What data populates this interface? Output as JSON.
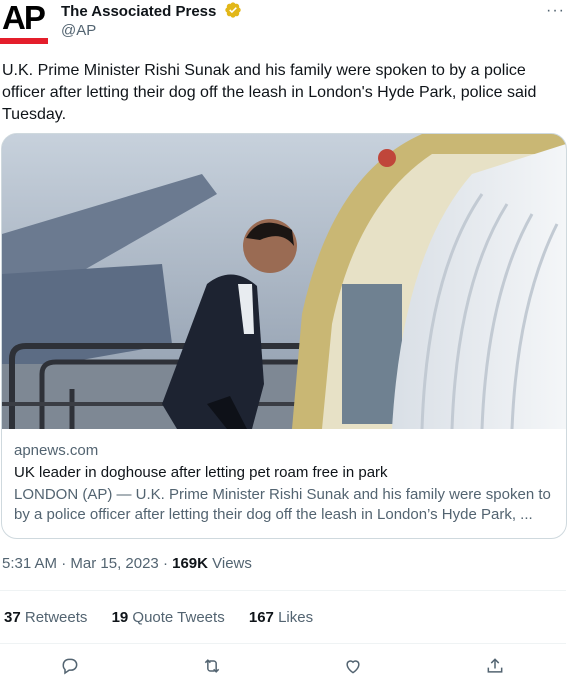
{
  "author": {
    "avatar_text": "AP",
    "display_name": "The Associated Press",
    "handle": "@AP",
    "verified_icon": "verified-badge-icon",
    "more_label": "···"
  },
  "tweet": {
    "text": "U.K. Prime Minister Rishi Sunak and his family were spoken to by a police officer after letting their dog off the leash in London's Hyde Park, police said Tuesday."
  },
  "card": {
    "image_alt": "Rishi Sunak boarding an aircraft",
    "domain": "apnews.com",
    "title": "UK leader in doghouse after letting pet roam free in park",
    "description": "LONDON (AP) — U.K. Prime Minister Rishi Sunak and his family were spoken to by a police officer after letting their dog off the leash in London’s Hyde Park, ..."
  },
  "meta": {
    "time": "5:31 AM",
    "separator": " · ",
    "date": "Mar 15, 2023",
    "views_count": "169K",
    "views_label": " Views"
  },
  "stats": {
    "retweets_count": "37",
    "retweets_label": " Retweets",
    "quotes_count": "19",
    "quotes_label": " Quote Tweets",
    "likes_count": "167",
    "likes_label": " Likes"
  },
  "colors": {
    "ap_red": "#e41e2b",
    "text_primary": "#0f1419",
    "text_secondary": "#536471",
    "border": "#cfd9de",
    "verified_gold": "#e2b719"
  },
  "icons": [
    "reply-icon",
    "retweet-icon",
    "like-icon",
    "share-icon"
  ]
}
